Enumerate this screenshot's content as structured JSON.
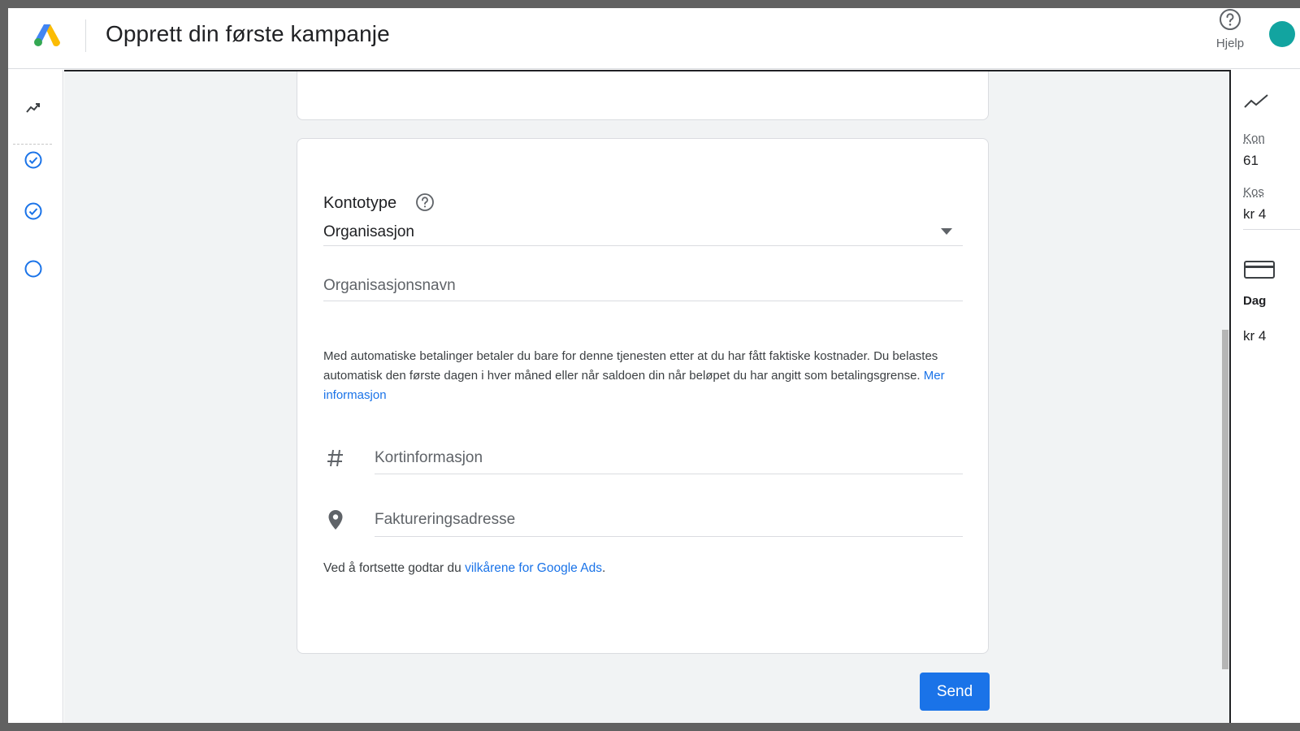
{
  "header": {
    "title": "Opprett din første kampanje",
    "help_label": "Hjelp"
  },
  "form": {
    "account_type_label": "Kontotype",
    "account_type_value": "Organisasjon",
    "org_name_placeholder": "Organisasjonsnavn",
    "info_text": "Med automatiske betalinger betaler du bare for denne tjenesten etter at du har fått faktiske kostnader. Du belastes automatisk den første dagen i hver måned eller når saldoen din når beløpet du har angitt som betalingsgrense.",
    "info_link": "Mer informasjon",
    "card_info_placeholder": "Kortinformasjon",
    "billing_address_placeholder": "Faktureringsadresse",
    "terms_prefix": "Ved å fortsette godtar du",
    "terms_link": "vilkårene for Google Ads",
    "terms_suffix": ".",
    "send_label": "Send"
  },
  "right_panel": {
    "label_1": "Kon",
    "value_1": "61",
    "label_2": "Kos",
    "value_2": "kr 4",
    "label_3": "Dag",
    "value_3": "kr 4"
  },
  "colors": {
    "accent": "#1a73e8",
    "background": "#f1f3f4"
  }
}
